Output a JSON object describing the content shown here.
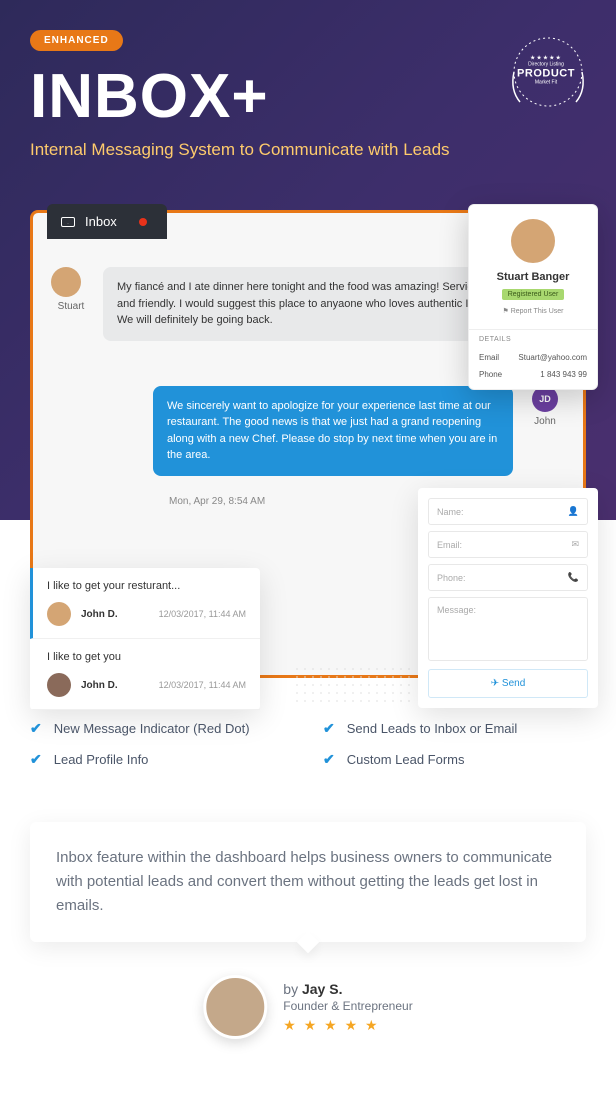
{
  "hero": {
    "badge": "ENHANCED",
    "title": "INBOX+",
    "subtitle": "Internal Messaging System to Communicate with Leads"
  },
  "product_badge": {
    "dir": "Directory Listing",
    "prod": "PRODUCT",
    "fit": "Market Fit"
  },
  "inbox_tab": "Inbox",
  "messages": {
    "stuart_label": "Stuart",
    "msg1": "My fiancé and I ate dinner here tonight and the food was amazing! Service was prompt and friendly. I would suggest this place to anyaone who loves authentic Indian cuisine. We will definitely be going back.",
    "ts1": "Mon, Apr 29, 8:54 AM",
    "msg2": "We sincerely want to apologize for your experience last time at our restaurant. The good news is that we just had a grand reopening along with a new Chef. Please do stop by next time when you are in the area.",
    "ts2": "Mon, Apr 29, 8:54 AM",
    "john_initials": "JD",
    "john_label": "John"
  },
  "profile": {
    "name": "Stuart Banger",
    "tag": "Registered User",
    "report": "⚑ Report This User",
    "details_label": "DETAILS",
    "email_label": "Email",
    "email_value": "Stuart@yahoo.com",
    "phone_label": "Phone",
    "phone_value": "1 843 943 99"
  },
  "conversations": [
    {
      "subject": "I like to get your resturant...",
      "name": "John D.",
      "time": "12/03/2017, 11:44 AM"
    },
    {
      "subject": "I like to get you",
      "name": "John D.",
      "time": "12/03/2017, 11:44 AM"
    }
  ],
  "lead_form": {
    "name": "Name:",
    "email": "Email:",
    "phone": "Phone:",
    "message": "Message:",
    "send": "Send"
  },
  "features": [
    "New Message Indicator (Red Dot)",
    "Send Leads to Inbox or Email",
    "Lead Profile Info",
    "Custom Lead Forms"
  ],
  "quote": "Inbox feature within the dashboard helps business owners to communicate with potential leads and convert them without getting the leads get lost in emails.",
  "author": {
    "by_prefix": "by ",
    "name": "Jay S.",
    "role": "Founder & Entrepreneur",
    "stars": "★ ★ ★ ★ ★"
  }
}
